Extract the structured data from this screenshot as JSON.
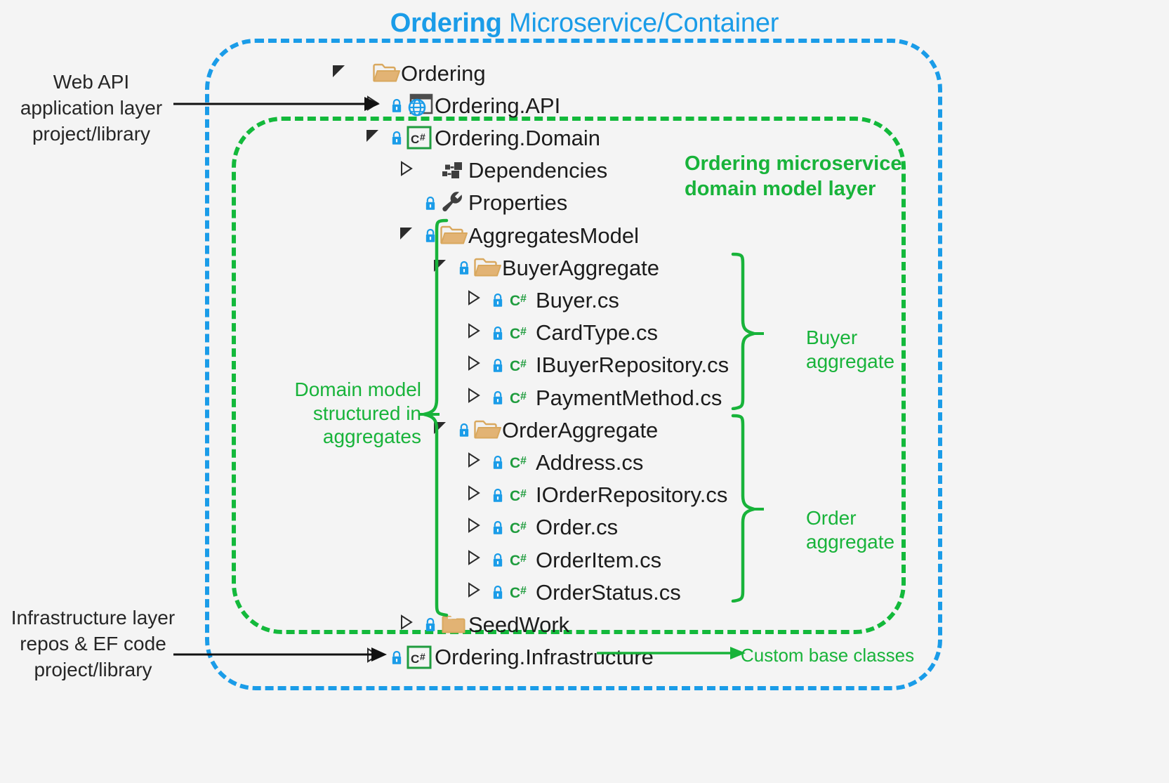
{
  "title": {
    "bold": "Ordering",
    "rest": " Microservice/Container"
  },
  "colors": {
    "blue": "#1a9ce8",
    "green": "#18b33a",
    "folder": "#e0b878",
    "csharp_green": "#1f9c3e",
    "text": "#1c1c1c"
  },
  "containers": {
    "outer_label": "Ordering Microservice/Container",
    "inner_label": "Ordering microservice domain model layer"
  },
  "tree": [
    {
      "name": "Ordering",
      "indent": 0,
      "state": "expanded",
      "icon": "folder-open-icon",
      "lock": false
    },
    {
      "name": "Ordering.API",
      "indent": 1,
      "state": "collapsed",
      "icon": "web-project-icon",
      "lock": true
    },
    {
      "name": "Ordering.Domain",
      "indent": 1,
      "state": "expanded",
      "icon": "csharp-project-icon",
      "lock": true
    },
    {
      "name": "Dependencies",
      "indent": 2,
      "state": "collapsed",
      "icon": "dependencies-icon",
      "lock": false
    },
    {
      "name": "Properties",
      "indent": 2,
      "state": "none",
      "icon": "wrench-icon",
      "lock": true
    },
    {
      "name": "AggregatesModel",
      "indent": 2,
      "state": "expanded",
      "icon": "folder-open-icon",
      "lock": true
    },
    {
      "name": "BuyerAggregate",
      "indent": 3,
      "state": "expanded",
      "icon": "folder-open-icon",
      "lock": true
    },
    {
      "name": "Buyer.cs",
      "indent": 4,
      "state": "collapsed",
      "icon": "csharp-file-icon",
      "lock": true
    },
    {
      "name": "CardType.cs",
      "indent": 4,
      "state": "collapsed",
      "icon": "csharp-file-icon",
      "lock": true
    },
    {
      "name": "IBuyerRepository.cs",
      "indent": 4,
      "state": "collapsed",
      "icon": "csharp-file-icon",
      "lock": true
    },
    {
      "name": "PaymentMethod.cs",
      "indent": 4,
      "state": "collapsed",
      "icon": "csharp-file-icon",
      "lock": true
    },
    {
      "name": "OrderAggregate",
      "indent": 3,
      "state": "expanded",
      "icon": "folder-open-icon",
      "lock": true
    },
    {
      "name": "Address.cs",
      "indent": 4,
      "state": "collapsed",
      "icon": "csharp-file-icon",
      "lock": true
    },
    {
      "name": "IOrderRepository.cs",
      "indent": 4,
      "state": "collapsed",
      "icon": "csharp-file-icon",
      "lock": true
    },
    {
      "name": "Order.cs",
      "indent": 4,
      "state": "collapsed",
      "icon": "csharp-file-icon",
      "lock": true
    },
    {
      "name": "OrderItem.cs",
      "indent": 4,
      "state": "collapsed",
      "icon": "csharp-file-icon",
      "lock": true
    },
    {
      "name": "OrderStatus.cs",
      "indent": 4,
      "state": "collapsed",
      "icon": "csharp-file-icon",
      "lock": true
    },
    {
      "name": "SeedWork",
      "indent": 2,
      "state": "collapsed",
      "icon": "folder-closed-icon",
      "lock": true
    },
    {
      "name": "Ordering.Infrastructure",
      "indent": 1,
      "state": "collapsed",
      "icon": "csharp-project-icon",
      "lock": true
    }
  ],
  "annotations": {
    "web_api": {
      "line1": "Web API",
      "line2": "application layer",
      "line3": "project/library"
    },
    "infrastructure": {
      "line1": "Infrastructure layer",
      "line2": "repos & EF code",
      "line3": "project/library"
    },
    "domain_layer": {
      "line1": "Ordering microservice",
      "line2": "domain model layer"
    },
    "domain_model": {
      "line1": "Domain model",
      "line2": "structured in",
      "line3": "aggregates"
    },
    "buyer_aggregate": {
      "line1": "Buyer",
      "line2": "aggregate"
    },
    "order_aggregate": {
      "line1": "Order",
      "line2": "aggregate"
    },
    "seedwork": "Custom base classes"
  }
}
